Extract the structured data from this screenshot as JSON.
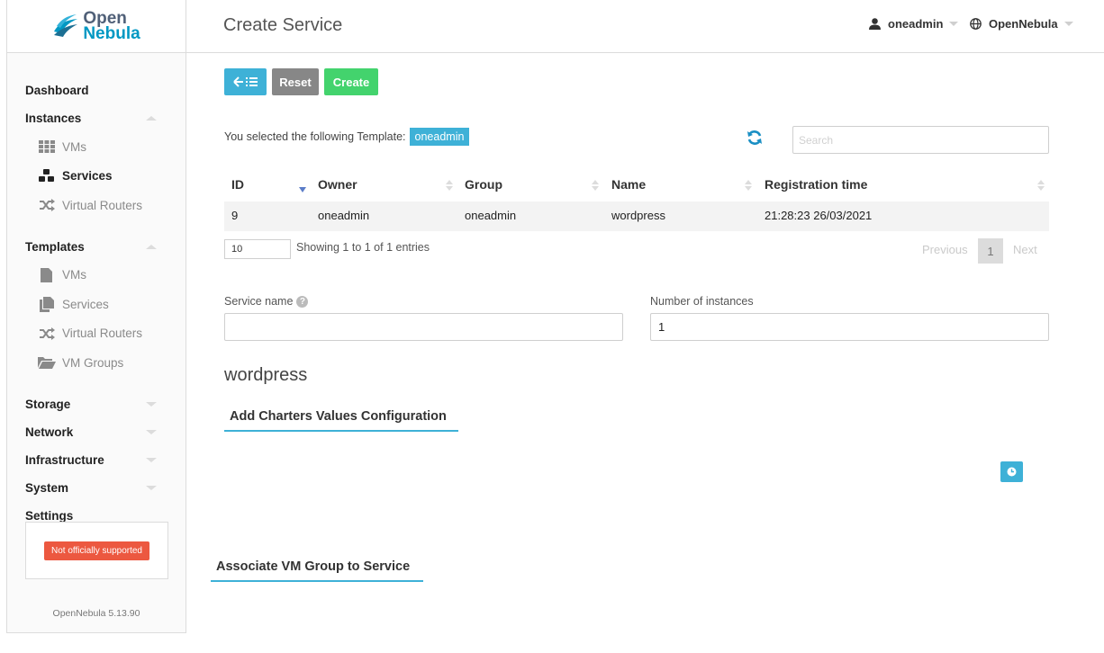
{
  "logo": {
    "line1": "Open",
    "line2": "Nebula"
  },
  "header": {
    "title": "Create Service",
    "user": "oneadmin",
    "zone": "OpenNebula"
  },
  "sidebar": {
    "dashboard": "Dashboard",
    "instances": {
      "label": "Instances",
      "items": [
        "VMs",
        "Services",
        "Virtual Routers"
      ]
    },
    "templates": {
      "label": "Templates",
      "items": [
        "VMs",
        "Services",
        "Virtual Routers",
        "VM Groups"
      ]
    },
    "storage": "Storage",
    "network": "Network",
    "infrastructure": "Infrastructure",
    "system": "System",
    "settings": "Settings",
    "support_badge": "Not officially supported",
    "version": "OpenNebula 5.13.90"
  },
  "toolbar": {
    "reset": "Reset",
    "create": "Create"
  },
  "template_select": {
    "text": "You selected the following Template:",
    "selected": "oneadmin",
    "search_placeholder": "Search"
  },
  "table": {
    "columns": [
      "ID",
      "Owner",
      "Group",
      "Name",
      "Registration time"
    ],
    "rows": [
      {
        "id": "9",
        "owner": "oneadmin",
        "group": "oneadmin",
        "name": "wordpress",
        "registration": "21:28:23 26/03/2021"
      }
    ],
    "page_length": "10",
    "info": "Showing 1 to 1 of 1 entries",
    "prev": "Previous",
    "page": "1",
    "next": "Next"
  },
  "form": {
    "service_name_label": "Service name",
    "service_name_value": "",
    "instances_label": "Number of instances",
    "instances_value": "1"
  },
  "template_name": "wordpress",
  "sections": {
    "charters": "Add Charters Values Configuration",
    "vm_group": "Associate VM Group to Service"
  },
  "colors": {
    "accent": "#3eb1d7",
    "success": "#43d36d",
    "secondary": "#878787",
    "alert": "#ec5840"
  }
}
